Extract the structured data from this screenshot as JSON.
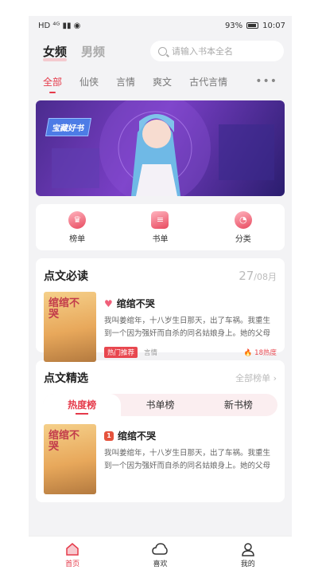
{
  "status": {
    "left": "HD ⁴ᴳ ▮▮ ◉",
    "battery": "93%",
    "time": "10:07"
  },
  "gender": {
    "female": "女频",
    "male": "男频"
  },
  "search": {
    "placeholder": "请输入书本全名"
  },
  "tabs": [
    "全部",
    "仙侠",
    "言情",
    "爽文",
    "古代言情"
  ],
  "more": "•••",
  "banner": {
    "badge": "宝藏好书"
  },
  "quick": [
    {
      "label": "榜单",
      "icon": "crown-icon"
    },
    {
      "label": "书单",
      "icon": "list-icon"
    },
    {
      "label": "分类",
      "icon": "pie-icon"
    }
  ],
  "must_read": {
    "title": "点文必读",
    "date_day": "27",
    "date_month": "/08月",
    "book": {
      "cover_title": "绾绾不哭",
      "title": "绾绾不哭",
      "desc": "我叫姜绾年，十八岁生日那天，出了车祸。我重生到一个因为强奸而自杀的同名姑娘身上。她的父母以…",
      "tag": "热门推荐",
      "genre": "言情",
      "heat": "18热度"
    }
  },
  "selection": {
    "title": "点文精选",
    "all": "全部榜单 ›",
    "rank_tabs": [
      "热度榜",
      "书单榜",
      "新书榜"
    ],
    "book": {
      "rank": "1",
      "cover_title": "绾绾不哭",
      "title": "绾绾不哭",
      "desc": "我叫姜绾年，十八岁生日那天，出了车祸。我重生到一个因为强奸而自杀的同名姑娘身上。她的父母以…"
    }
  },
  "nav": [
    {
      "label": "首页"
    },
    {
      "label": "喜欢"
    },
    {
      "label": "我的"
    }
  ]
}
